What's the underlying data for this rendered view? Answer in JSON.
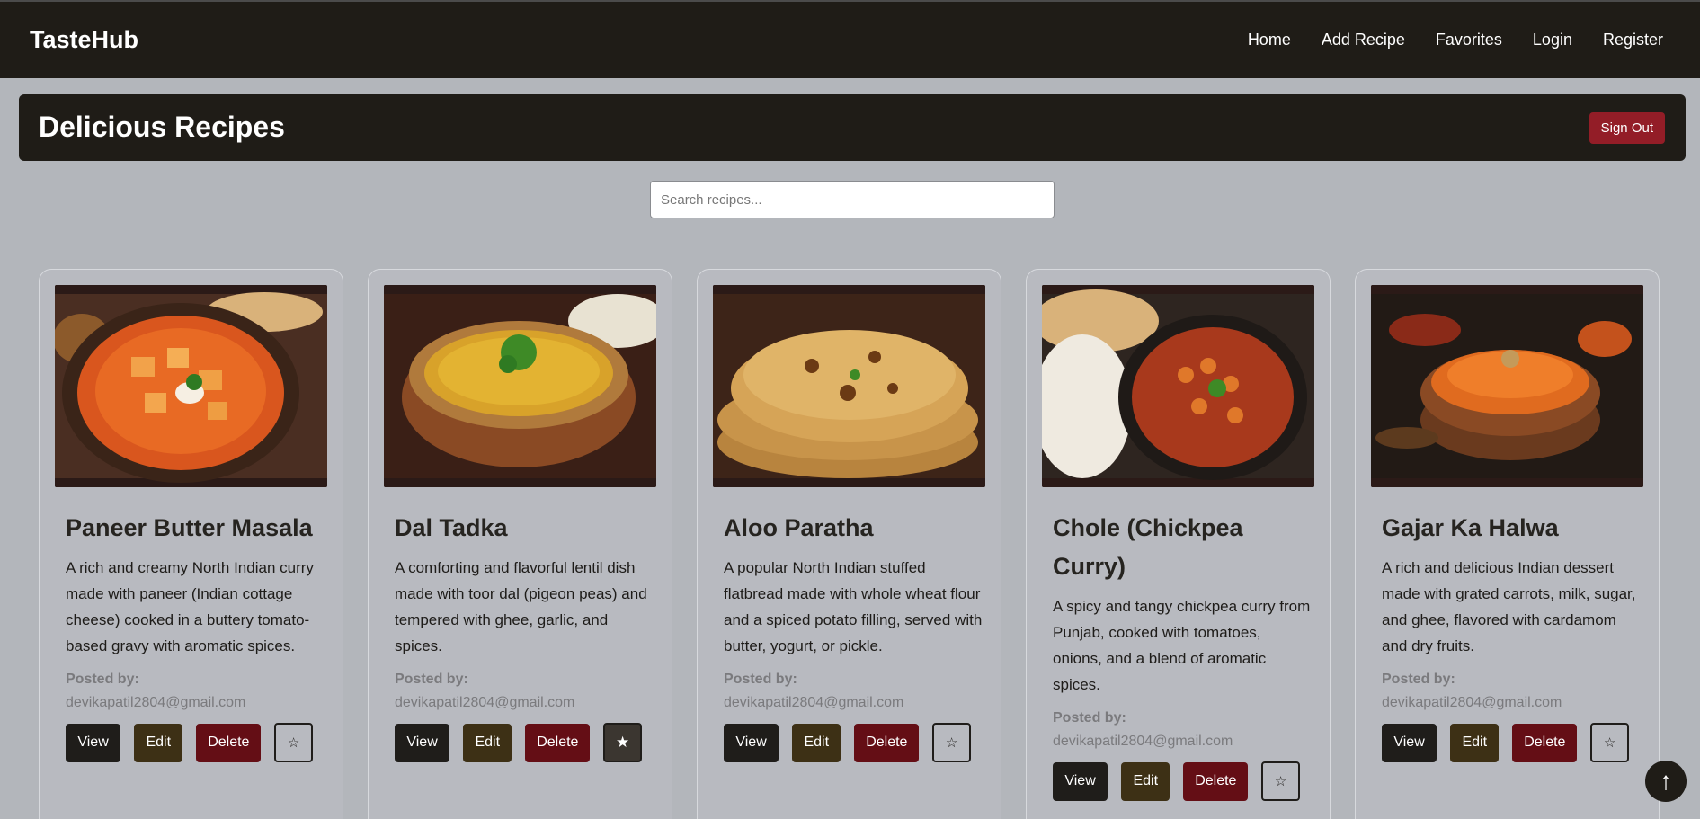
{
  "navbar": {
    "brand": "TasteHub",
    "links": [
      "Home",
      "Add Recipe",
      "Favorites",
      "Login",
      "Register"
    ]
  },
  "banner": {
    "title": "Delicious Recipes",
    "sign_out": "Sign Out"
  },
  "search": {
    "placeholder": "Search recipes..."
  },
  "labels": {
    "posted_by": "Posted by:",
    "view": "View",
    "edit": "Edit",
    "delete": "Delete",
    "favorite_icon": "☆",
    "favorited_icon": "★"
  },
  "recipes": [
    {
      "title": "Paneer Butter Masala",
      "description": "A rich and creamy North Indian curry made with paneer (Indian cottage cheese) cooked in a buttery tomato-based gravy with aromatic spices.",
      "email": "devikapatil2804@gmail.com",
      "favorited": false
    },
    {
      "title": "Dal Tadka",
      "description": "A comforting and flavorful lentil dish made with toor dal (pigeon peas) and tempered with ghee, garlic, and spices.",
      "email": "devikapatil2804@gmail.com",
      "favorited": true
    },
    {
      "title": "Aloo Paratha",
      "description": "A popular North Indian stuffed flatbread made with whole wheat flour and a spiced potato filling, served with butter, yogurt, or pickle.",
      "email": "devikapatil2804@gmail.com",
      "favorited": false
    },
    {
      "title": "Chole (Chickpea Curry)",
      "description": "A spicy and tangy chickpea curry from Punjab, cooked with tomatoes, onions, and a blend of aromatic spices.",
      "email": "devikapatil2804@gmail.com",
      "favorited": false
    },
    {
      "title": "Gajar Ka Halwa",
      "description": "A rich and delicious Indian dessert made with grated carrots, milk, sugar, and ghee, flavored with cardamom and dry fruits.",
      "email": "devikapatil2804@gmail.com",
      "favorited": false
    }
  ],
  "scroll_top_icon": "↑",
  "colors": {
    "nav_bg": "#1f1c17",
    "page_bg": "#b3b6bb",
    "sign_out": "#931d27",
    "view_btn": "#1f1d1a",
    "edit_btn": "#3d3015",
    "delete_btn": "#640e15"
  }
}
